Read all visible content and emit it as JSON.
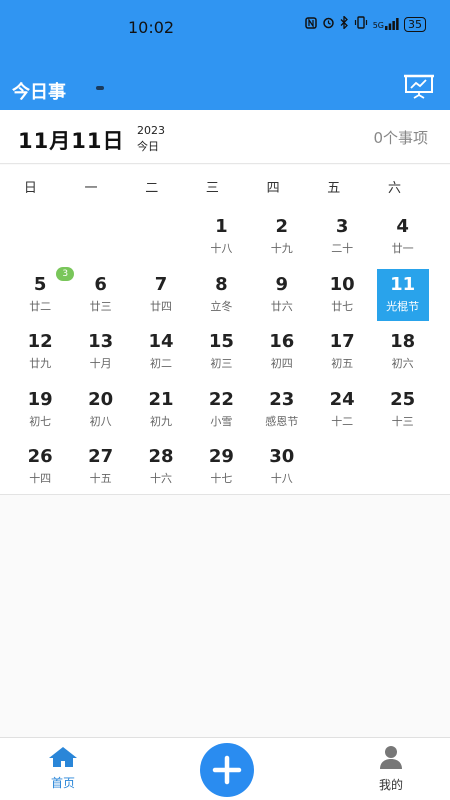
{
  "status_bar": {
    "time": "10:02",
    "network": "5G",
    "battery": "35"
  },
  "header": {
    "title": "今日事",
    "screen_icon": "presentation-screen-icon"
  },
  "date_header": {
    "date": "11月11日",
    "year": "2023",
    "today_label": "今日",
    "count_label": "0个事项"
  },
  "weekdays": [
    "日",
    "一",
    "二",
    "三",
    "四",
    "五",
    "六"
  ],
  "calendar": {
    "days": [
      {
        "day": "1",
        "lunar": "十八"
      },
      {
        "day": "2",
        "lunar": "十九"
      },
      {
        "day": "3",
        "lunar": "二十"
      },
      {
        "day": "4",
        "lunar": "廿一"
      },
      {
        "day": "5",
        "lunar": "廿二"
      },
      {
        "day": "6",
        "lunar": "廿三"
      },
      {
        "day": "7",
        "lunar": "廿四"
      },
      {
        "day": "8",
        "lunar": "立冬"
      },
      {
        "day": "9",
        "lunar": "廿六"
      },
      {
        "day": "10",
        "lunar": "廿七"
      },
      {
        "day": "11",
        "lunar": "光棍节"
      },
      {
        "day": "12",
        "lunar": "廿九"
      },
      {
        "day": "13",
        "lunar": "十月"
      },
      {
        "day": "14",
        "lunar": "初二"
      },
      {
        "day": "15",
        "lunar": "初三"
      },
      {
        "day": "16",
        "lunar": "初四"
      },
      {
        "day": "17",
        "lunar": "初五"
      },
      {
        "day": "18",
        "lunar": "初六"
      },
      {
        "day": "19",
        "lunar": "初七"
      },
      {
        "day": "20",
        "lunar": "初八"
      },
      {
        "day": "21",
        "lunar": "初九"
      },
      {
        "day": "22",
        "lunar": "小雪"
      },
      {
        "day": "23",
        "lunar": "感恩节"
      },
      {
        "day": "24",
        "lunar": "十二"
      },
      {
        "day": "25",
        "lunar": "十三"
      },
      {
        "day": "26",
        "lunar": "十四"
      },
      {
        "day": "27",
        "lunar": "十五"
      },
      {
        "day": "28",
        "lunar": "十六"
      },
      {
        "day": "29",
        "lunar": "十七"
      },
      {
        "day": "30",
        "lunar": "十八"
      }
    ],
    "badge": {
      "day": "5",
      "count": "3"
    },
    "selected_day": "11"
  },
  "bottom_nav": {
    "home_label": "首页",
    "home_icon": "home-icon",
    "add_icon": "plus-icon",
    "mine_label": "我的",
    "mine_icon": "user-icon"
  },
  "colors": {
    "primary": "#3095f2",
    "today": "#29a3eb",
    "badge": "#79c65a"
  }
}
